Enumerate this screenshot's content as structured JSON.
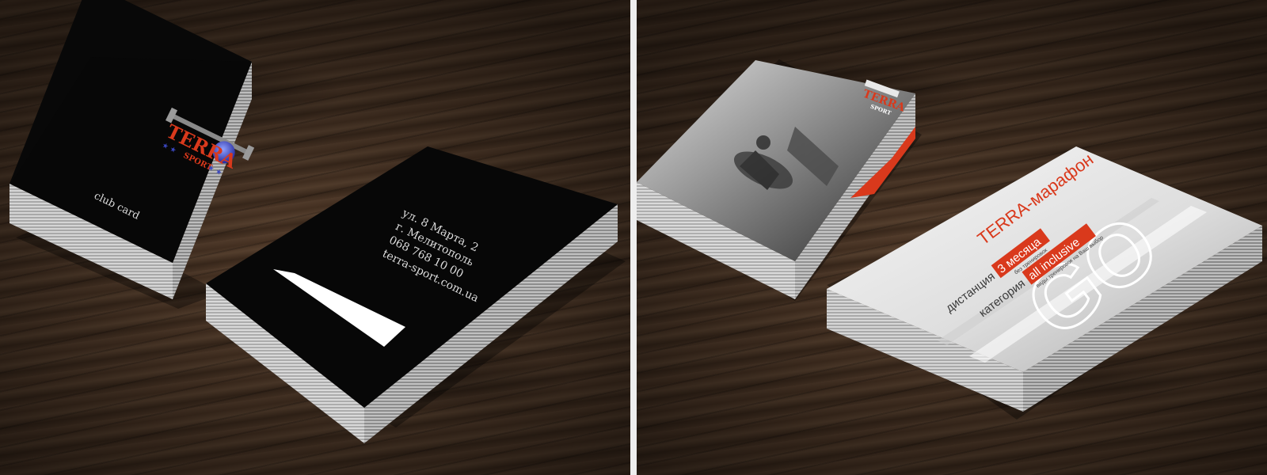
{
  "left_panel": {
    "front_card": {
      "brand": "TERRA",
      "sub_brand": "SPORT",
      "label": "club card"
    },
    "back_card": {
      "address_line1": "ул. 8 Марта, 2",
      "address_line2": "г. Мелитополь",
      "phone": "068 768 10 00",
      "website": "terra-sport.com.ua"
    }
  },
  "right_panel": {
    "photo_card": {
      "brand": "TERRA",
      "sub_brand": "SPORT"
    },
    "promo_card": {
      "headline": "TERRA-марафон",
      "distance_label": "дистанция",
      "distance_value": "3 месяца",
      "distance_note": "без тренировок",
      "category_label": "категория",
      "category_value": "all inclusive",
      "category_note": "виды тренировок на Ваш выбор",
      "big_text": "GO"
    }
  },
  "colors": {
    "accent_red": "#d9391c",
    "card_black": "#070707",
    "wood": "#4b3526"
  }
}
